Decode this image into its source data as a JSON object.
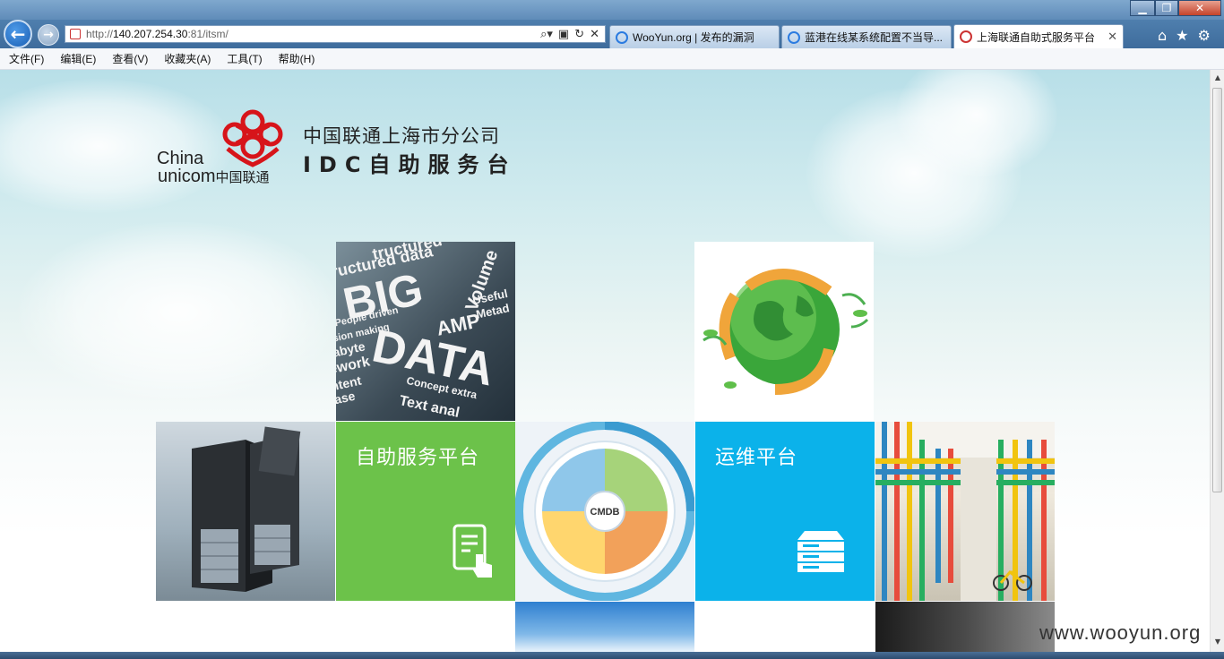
{
  "browser": {
    "address": {
      "url_prefix": "http://",
      "url_host": "140.207.254.30",
      "url_rest": ":81/itsm/"
    },
    "tabs": [
      {
        "label": "WooYun.org | 发布的漏洞"
      },
      {
        "label": "蓝港在线某系统配置不当导..."
      },
      {
        "label": "上海联通自助式服务平台",
        "close": "✕"
      }
    ],
    "window_controls": {
      "minimize": "▁",
      "maximize": "❐",
      "close": "✕"
    },
    "toolbar_icons": {
      "home": "⌂",
      "favorites": "★",
      "settings": "⚙"
    },
    "address_tools": {
      "search": "⌕▾",
      "compat": "▣",
      "refresh": "↻",
      "stop": "✕"
    },
    "nav": {
      "back": "←",
      "forward": "→"
    }
  },
  "menu": [
    "文件(F)",
    "编辑(E)",
    "查看(V)",
    "收藏夹(A)",
    "工具(T)",
    "帮助(H)"
  ],
  "logo": {
    "brand_en_1": "China",
    "brand_en_2": "unicom",
    "brand_cn": "中国联通",
    "title_line1": "中国联通上海市分公司",
    "title_line2": "IDC自助服务台"
  },
  "tiles": {
    "self_service": {
      "label": "自助服务平台",
      "color": "#6cc24a"
    },
    "ops": {
      "label": "运维平台",
      "color": "#0bb2ea"
    },
    "bigdata_words": [
      "tructured",
      "ructured data",
      "BIG",
      "Volume",
      "Useful",
      "People driven",
      "Metad",
      "AMP",
      "sion making",
      "DATA",
      "abyte",
      "ework",
      "ntent",
      "Concept extra",
      "Text anal",
      "ase"
    ],
    "cmdb": {
      "center": "CMDB"
    }
  },
  "watermark": "www.wooyun.org"
}
